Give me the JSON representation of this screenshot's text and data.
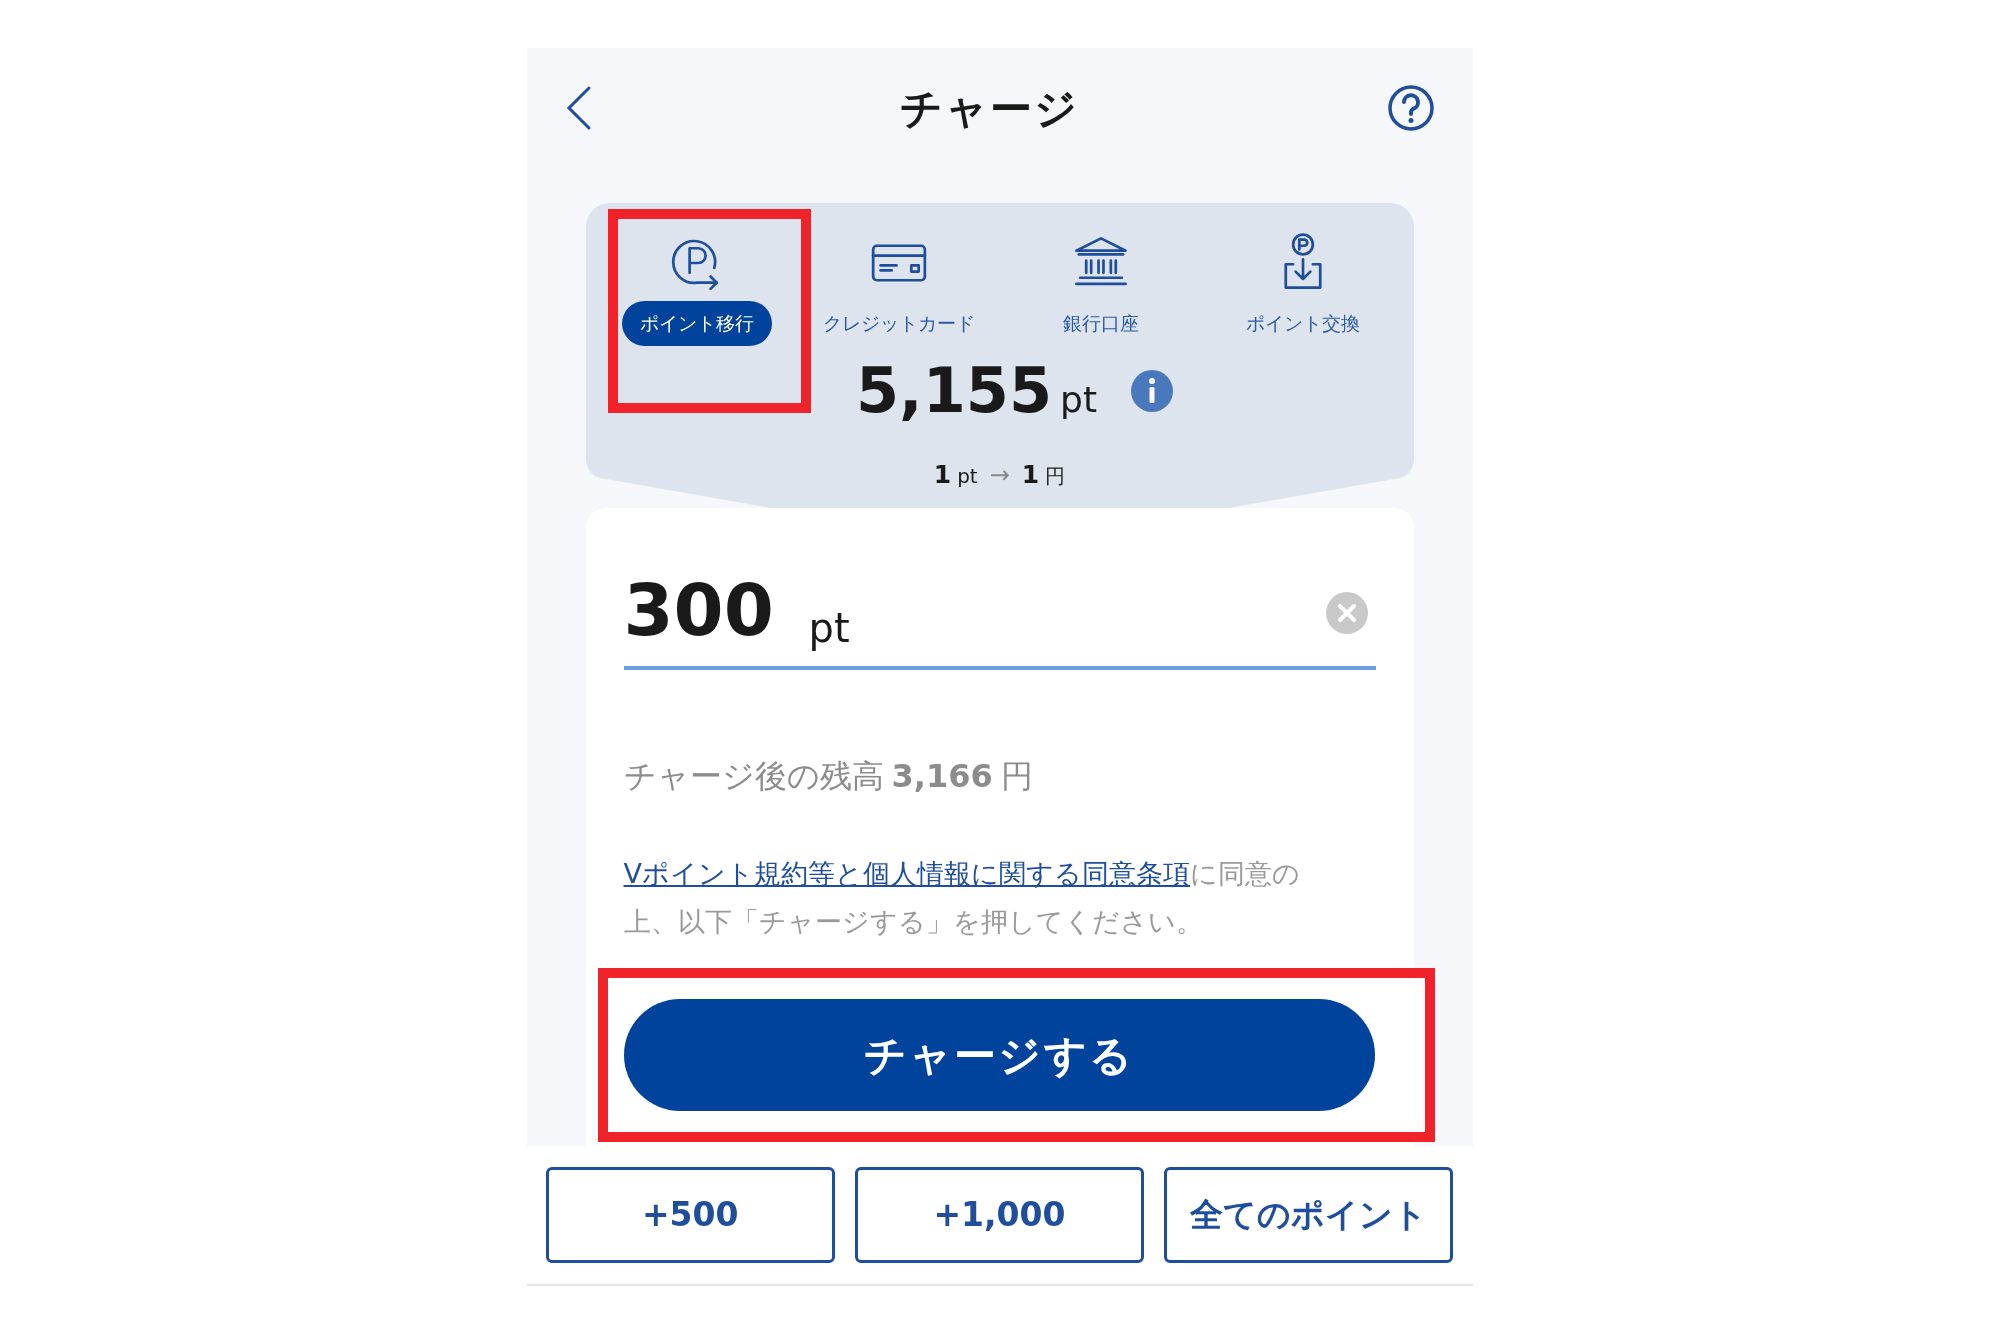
{
  "header": {
    "title": "チャージ"
  },
  "methods": [
    {
      "kind": "transfer",
      "label": "ポイント移行",
      "selected": true,
      "highlighted": true
    },
    {
      "kind": "card",
      "label": "クレジットカード",
      "selected": false,
      "highlighted": false
    },
    {
      "kind": "bank",
      "label": "銀行口座",
      "selected": false,
      "highlighted": false
    },
    {
      "kind": "exchange",
      "label": "ポイント交換",
      "selected": false,
      "highlighted": false
    }
  ],
  "balance": {
    "value": "5,155",
    "unit": "pt"
  },
  "rate": {
    "from_value": "1",
    "from_unit": "pt",
    "arrow": "→",
    "to_value": "1",
    "to_unit": "円"
  },
  "amount": {
    "value": "300",
    "unit": "pt"
  },
  "after_charge": {
    "label": "チャージ後の残高",
    "value": "3,166",
    "unit": "円"
  },
  "consent": {
    "link": "Vポイント規約等と個人情報に関する同意条項",
    "text": "に同意の上、以下「チャージする」を押してください。"
  },
  "charge_button": {
    "label": "チャージする",
    "highlighted": true
  },
  "quick_buttons": [
    "+500",
    "+1,000",
    "全てのポイント"
  ]
}
